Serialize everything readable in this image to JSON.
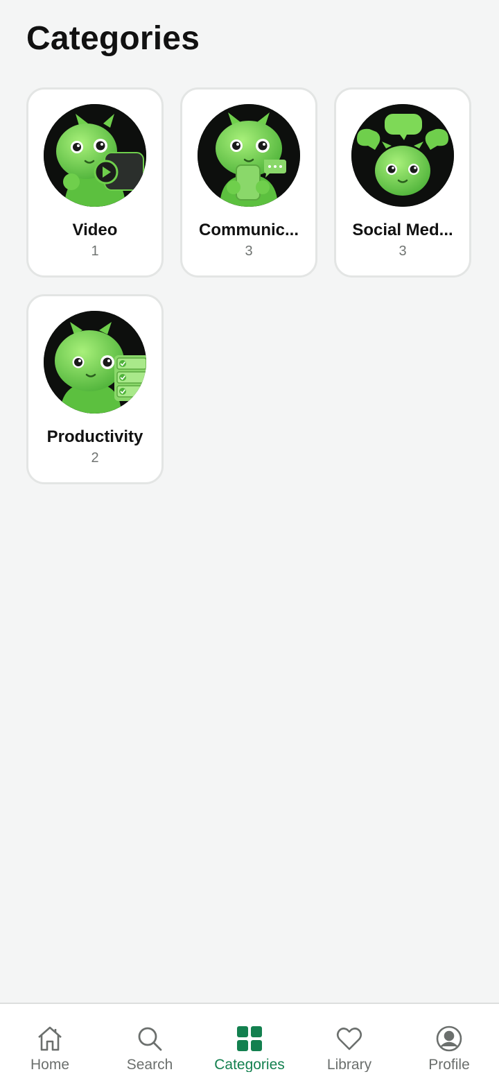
{
  "header": {
    "title": "Categories"
  },
  "categories": [
    {
      "name": "Video",
      "count": "1",
      "icon": "robot-video-icon"
    },
    {
      "name": "Communic...",
      "count": "3",
      "icon": "robot-chat-phone-icon"
    },
    {
      "name": "Social Med...",
      "count": "3",
      "icon": "robot-social-bubbles-icon"
    },
    {
      "name": "Productivity",
      "count": "2",
      "icon": "robot-checklist-icon"
    }
  ],
  "nav": {
    "items": [
      {
        "label": "Home",
        "icon": "home-icon",
        "active": false
      },
      {
        "label": "Search",
        "icon": "search-icon",
        "active": false
      },
      {
        "label": "Categories",
        "icon": "grid-icon",
        "active": true
      },
      {
        "label": "Library",
        "icon": "heart-icon",
        "active": false
      },
      {
        "label": "Profile",
        "icon": "profile-icon",
        "active": false
      }
    ]
  },
  "colors": {
    "accent": "#13804f",
    "background": "#f4f5f5",
    "robot_green": "#7ed957",
    "avatar_bg": "#0d0f0d",
    "muted_text": "#6f7371"
  }
}
